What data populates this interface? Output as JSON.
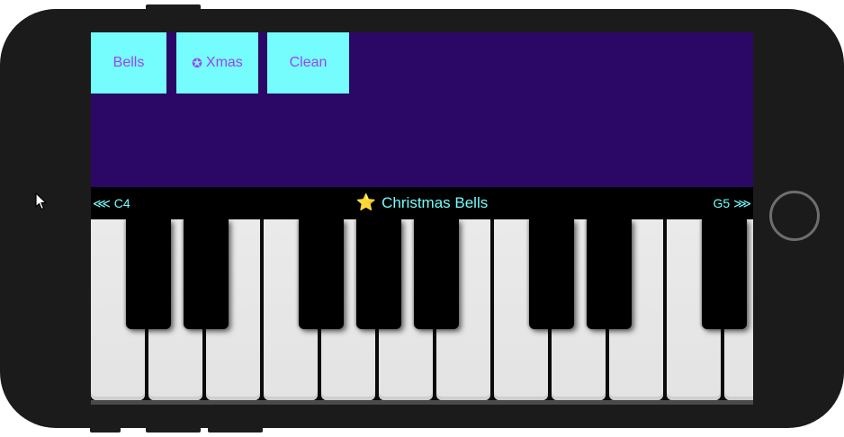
{
  "presets": [
    {
      "label": "Bells",
      "icon": ""
    },
    {
      "label": "Xmas",
      "icon": "✪"
    },
    {
      "label": "Clean",
      "icon": ""
    }
  ],
  "info_bar": {
    "range_low": "⋘ C4",
    "preset_name": "Christmas Bells",
    "preset_icon": "⭐",
    "range_high": "G5 ⋙"
  },
  "keyboard": {
    "white_keys": [
      "C4",
      "D4",
      "E4",
      "F4",
      "G4",
      "A4",
      "B4",
      "C5",
      "D5",
      "E5",
      "F5",
      "G5"
    ],
    "black_keys": [
      "C#4",
      "D#4",
      "F#4",
      "G#4",
      "A#4",
      "C#5",
      "D#5",
      "F#5"
    ]
  },
  "colors": {
    "panel": "#2b0766",
    "button_bg": "#74fdfc",
    "button_text": "#9b44f2",
    "info_text": "#74fdfc"
  }
}
